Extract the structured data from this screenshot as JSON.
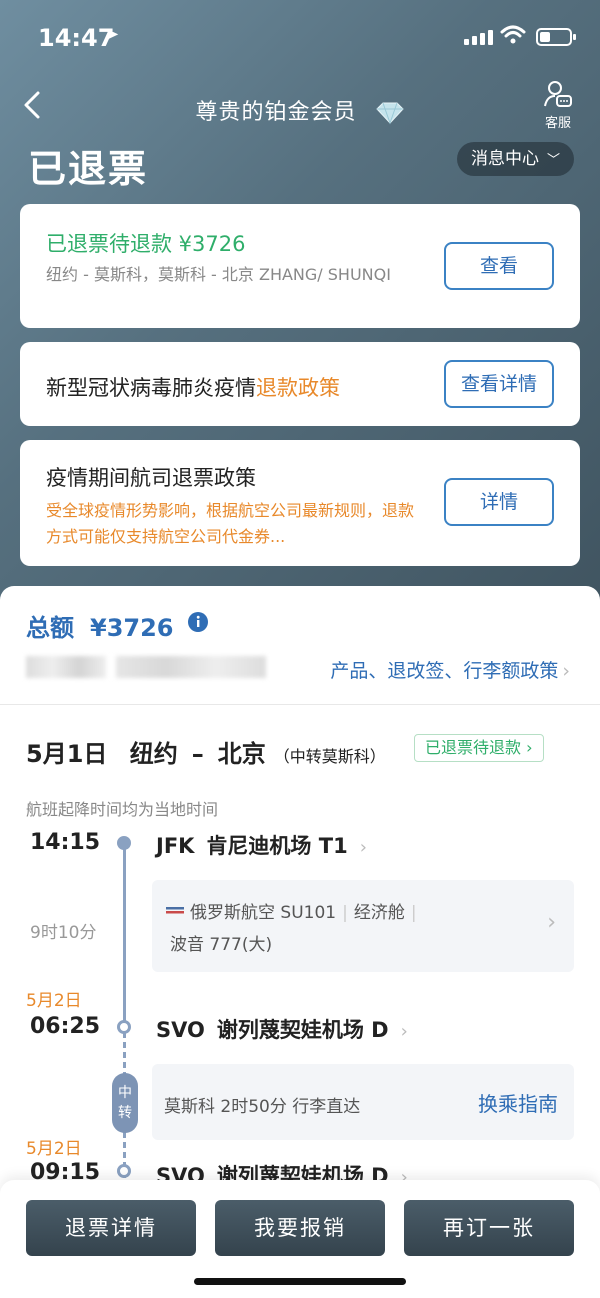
{
  "status_bar": {
    "time": "14:47",
    "location_glyph": "➤"
  },
  "nav": {
    "title": "尊贵的铂金会员",
    "customer_service": "客服"
  },
  "page_title": "已退票",
  "message_center": "消息中心",
  "cards": {
    "refund_status": {
      "title": "已退票待退款 ¥3726",
      "route": "纽约 - 莫斯科，莫斯科 - 北京 ZHANG/ SHUNQI",
      "button": "查看"
    },
    "covid_policy": {
      "title_prefix": "新型冠状病毒肺炎疫情",
      "title_highlight": "退款政策",
      "button": "查看详情"
    },
    "airline_policy": {
      "title": "疫情期间航司退票政策",
      "desc": "受全球疫情形势影响，根据航空公司最新规则，退款方式可能仅支持航空公司代金券...",
      "button": "详情"
    }
  },
  "summary": {
    "total_label": "总额",
    "total_amount": "¥3726",
    "policy_link": "产品、退改签、行李额政策"
  },
  "trip": {
    "date": "5月1日",
    "from": "纽约",
    "to": "北京",
    "via": "（中转莫斯科）",
    "status_tag": "已退票待退款",
    "note": "航班起降时间均为当地时间",
    "segments": {
      "dep1": {
        "time": "14:15",
        "code": "JFK",
        "airport": "肯尼迪机场 T1"
      },
      "flight1": {
        "airline": "俄罗斯航空 SU101",
        "cabin": "经济舱",
        "aircraft": "波音 777(大)",
        "duration": "9时10分"
      },
      "arr1": {
        "date": "5月2日",
        "time": "06:25",
        "code": "SVO",
        "airport": "谢列蔑契娃机场 D"
      },
      "transfer": {
        "pill": "中转",
        "info": "莫斯科  2时50分  行李直达",
        "guide": "换乘指南"
      },
      "dep2": {
        "date": "5月2日",
        "time": "09:15",
        "code": "SVO",
        "airport": "谢列蔑契娃机场 D"
      }
    }
  },
  "bottom_buttons": {
    "refund_detail": "退票详情",
    "reimburse": "我要报销",
    "rebook": "再订一张"
  },
  "colors": {
    "accent_blue": "#2f6db5",
    "green": "#2fae6a",
    "orange": "#e8892b",
    "hero_dark": "#3f535f"
  }
}
